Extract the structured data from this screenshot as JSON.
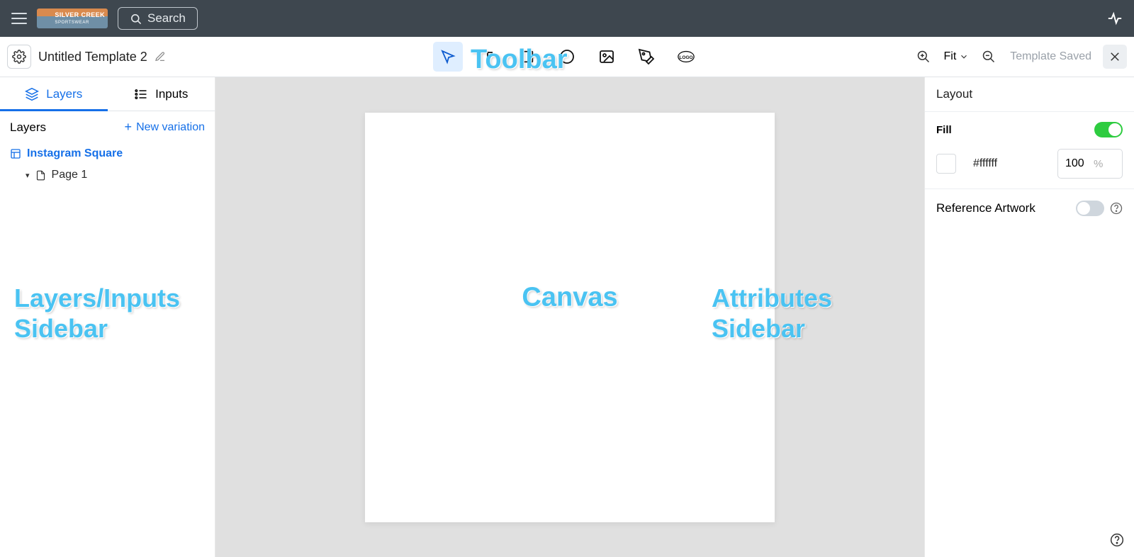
{
  "topbar": {
    "brand_name": "SILVER CREEK",
    "brand_sub": "SPORTSWEAR",
    "search_label": "Search"
  },
  "toolbar": {
    "template_title": "Untitled Template 2",
    "tools": [
      "select",
      "text",
      "rectangle",
      "ellipse",
      "image",
      "pen",
      "logo"
    ],
    "zoom_mode": "Fit",
    "status": "Template Saved"
  },
  "left": {
    "tabs": {
      "layers": "Layers",
      "inputs": "Inputs"
    },
    "active_tab": "layers",
    "panel_title": "Layers",
    "new_variation": "New variation",
    "tree": {
      "variation_name": "Instagram Square",
      "page_name": "Page 1"
    }
  },
  "right": {
    "section_title": "Layout",
    "fill": {
      "label": "Fill",
      "enabled": true,
      "hex": "#ffffff",
      "opacity": "100",
      "opacity_unit": "%"
    },
    "reference": {
      "label": "Reference Artwork",
      "enabled": false
    }
  },
  "annotations": {
    "toolbar": "Toolbar",
    "canvas": "Canvas",
    "left": "Layers/Inputs\nSidebar",
    "right": "Attributes\nSidebar"
  }
}
